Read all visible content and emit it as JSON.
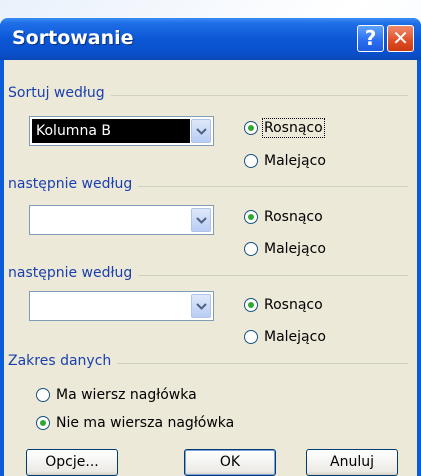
{
  "window": {
    "title": "Sortowanie"
  },
  "titlebar": {
    "help_label": "?",
    "close_label": "✕"
  },
  "sections": [
    {
      "label": "Sortuj według",
      "combo_value": "Kolumna B",
      "asc_label": "Rosnąco",
      "desc_label": "Malejąco",
      "selected": "asc"
    },
    {
      "label": "następnie według",
      "combo_value": "",
      "asc_label": "Rosnąco",
      "desc_label": "Malejąco",
      "selected": "asc"
    },
    {
      "label": "następnie według",
      "combo_value": "",
      "asc_label": "Rosnąco",
      "desc_label": "Malejąco",
      "selected": "asc"
    }
  ],
  "range": {
    "label": "Zakres danych",
    "option_header": "Ma wiersz nagłówka",
    "option_no_header": "Nie ma wiersza nagłówka",
    "selected": "no_header"
  },
  "buttons": {
    "options": "Opcje...",
    "ok": "OK",
    "cancel": "Anuluj"
  },
  "colors": {
    "accent": "#0a5bd8",
    "dialog_bg": "#ece9d8",
    "radio_dot": "#2fa82f",
    "group_label": "#1a3fae"
  }
}
